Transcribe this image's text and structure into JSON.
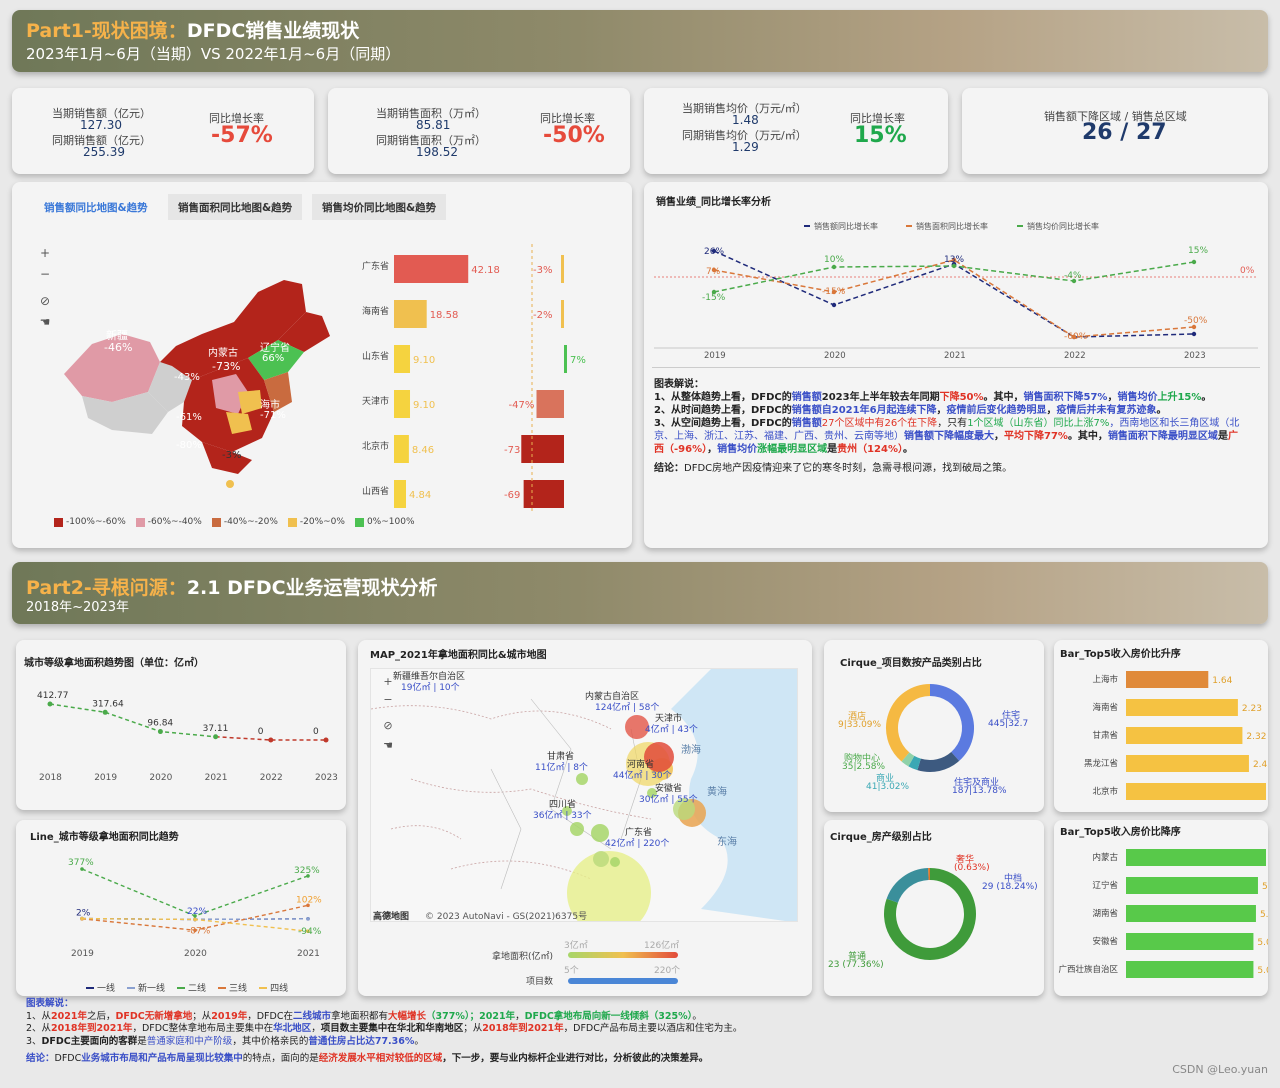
{
  "part1": {
    "title_hl": "Part1-现状困境",
    "title_sep": "：",
    "title_main": "DFDC销售业绩现状",
    "subtitle": "2023年1月~6月（当期）VS 2022年1月~6月（同期）"
  },
  "kpi": {
    "sales_cur_label": "当期销售额（亿元）",
    "sales_cur": "127.30",
    "sales_prev_label": "同期销售额（亿元）",
    "sales_prev": "255.39",
    "sales_yoy_label": "同比增长率",
    "sales_yoy": "-57%",
    "area_cur_label": "当期销售面积（万㎡）",
    "area_cur": "85.81",
    "area_prev_label": "同期销售面积（万㎡）",
    "area_prev": "198.52",
    "area_yoy_label": "同比增长率",
    "area_yoy": "-50%",
    "price_cur_label": "当期销售均价（万元/㎡）",
    "price_cur": "1.48",
    "price_prev_label": "同期销售均价（万元/㎡）",
    "price_prev": "1.29",
    "price_yoy_label": "同比增长率",
    "price_yoy": "15%",
    "region_label": "销售额下降区域 / 销售总区域",
    "region_value": "26 / 27"
  },
  "map_tabs": [
    "销售额同比地图&趋势",
    "销售面积同比地图&趋势",
    "销售均价同比地图&趋势"
  ],
  "map_labels": {
    "xinjiang": "新疆",
    "xinjiang_v": "-46%",
    "neimeng": "内蒙古",
    "liaoning": "辽宁省",
    "v66": "66%",
    "v73": "-73%",
    "v43": "-43%",
    "v61": "-61%",
    "v80": "-80%",
    "v3": "-3%",
    "shanghai": "海市",
    "v71": "-71%"
  },
  "provinces": {
    "names": [
      "广东省",
      "海南省",
      "山东省",
      "天津市",
      "北京市",
      "山西省"
    ],
    "values": [
      42.18,
      18.58,
      9.1,
      9.1,
      8.46,
      4.84
    ],
    "value_labels": [
      "42.18",
      "18.58",
      "9.10",
      "9.10",
      "8.46",
      "4.84"
    ],
    "yoy": [
      -3,
      -2,
      7,
      -47,
      -73,
      -69
    ],
    "yoy_labels": [
      "-3%",
      "-2%",
      "7%",
      "-47%",
      "-73",
      "-69"
    ]
  },
  "map_legend": [
    "-100%~-60%",
    "-60%~-40%",
    "-40%~-20%",
    "-20%~0%",
    "0%~100%"
  ],
  "map_legend_colors": [
    "#b3241b",
    "#e09aa6",
    "#c96b3f",
    "#f0c04f",
    "#4cc152"
  ],
  "trend": {
    "title": "销售业绩_同比增长率分析",
    "legend": [
      "销售额同比增长率",
      "销售面积同比增长率",
      "销售均价同比增长率"
    ],
    "chart_data": {
      "type": "line",
      "categories": [
        "2019",
        "2020",
        "2021",
        "2022",
        "2023"
      ],
      "series": [
        {
          "name": "销售额同比增长率",
          "values": [
            26,
            -28,
            13,
            -60,
            -57
          ],
          "color": "#1f2a7a"
        },
        {
          "name": "销售面积同比增长率",
          "values": [
            7,
            -15,
            17,
            -60,
            -50
          ],
          "color": "#d9773a"
        },
        {
          "name": "销售均价同比增长率",
          "values": [
            -15,
            10,
            11,
            -4,
            15
          ],
          "color": "#4aaa4a"
        }
      ],
      "point_labels": [
        "26%",
        "7%",
        "-15%",
        "10%",
        "-15%",
        "13%",
        "-4%",
        "-60%",
        "15%",
        "-50%",
        "0%"
      ]
    }
  },
  "analysis1": {
    "title": "图表解说：",
    "l1a": "1、从整体趋势上看，DFDC的",
    "l1b": "销售额",
    "l1c": "2023年上半年较去年同期",
    "l1d": "下降50%",
    "l1e": "。其中，",
    "l1f": "销售面积下降57%",
    "l1g": "，",
    "l1h": "销售均价",
    "l1i": "上升15%",
    "l1j": "。",
    "l2a": "2、从时间趋势上看，DFDC的",
    "l2b": "销售额自2021年6月起连续下降",
    "l2c": "，",
    "l2d": "疫情前后变化趋势明显",
    "l2e": "，",
    "l2f": "疫情后并未有复苏迹象",
    "l2g": "。",
    "l3a": "3、从空间趋势上看，DFDC的",
    "l3b": "销售额",
    "l3c": "27个区域中有26个在下降",
    "l3d": "，只有",
    "l3e": "1个区域（山东省）同比上涨7%",
    "l3f": "，西南地区和长三角区域（北",
    "l4a": "京、上海、浙江、江苏、福建、广西、贵州、云南等地）",
    "l4b": "销售额下降幅度最大",
    "l4c": "，",
    "l4d": "平均下降77%",
    "l4e": "。其中，",
    "l4f": "销售面积下降最明显区域",
    "l4g": "是",
    "l4h": "广",
    "l5a": "西（-96%）",
    "l5b": "，",
    "l5c": "销售均价",
    "l5d": "涨幅最明显区域",
    "l5e": "是",
    "l5f": "贵州（124%）",
    "l5g": "。",
    "conclusion_label": "结论：",
    "conclusion": "DFDC房地产因疫情迎来了它的寒冬时刻，急需寻根问源，找到破局之策。"
  },
  "part2": {
    "title_hl": "Part2-寻根问源",
    "title_sep": "：",
    "title_main": "2.1 DFDC业务运营现状分析",
    "subtitle": "2018年~2023年"
  },
  "land_area": {
    "title": "城市等级拿地面积趋势图（单位：亿㎡）",
    "chart_data": {
      "type": "line",
      "categories": [
        "2018",
        "2019",
        "2020",
        "2021",
        "2022",
        "2023"
      ],
      "values": [
        412.77,
        317.64,
        96.84,
        37.11,
        0,
        0
      ],
      "labels": [
        "412.77",
        "317.64",
        "96.84",
        "37.11",
        "0",
        "0"
      ]
    }
  },
  "land_yoy": {
    "title": "Line_城市等级拿地面积同比趋势",
    "chart_data": {
      "type": "line",
      "categories": [
        "2019",
        "2020",
        "2021"
      ],
      "series": [
        {
          "name": "一线",
          "color": "#1f2a7a",
          "values": [
            2,
            -5,
            0
          ]
        },
        {
          "name": "新一线",
          "color": "#8aa0d0",
          "values": [
            0,
            -5,
            0
          ]
        },
        {
          "name": "二线",
          "color": "#4aaa4a",
          "values": [
            377,
            22,
            325
          ]
        },
        {
          "name": "三线",
          "color": "#d9773a",
          "values": [
            0,
            -87,
            102
          ]
        },
        {
          "name": "四线",
          "color": "#f0c04f",
          "values": [
            2,
            -5,
            -94
          ]
        }
      ],
      "point_labels": [
        "377%",
        "2%",
        "22%",
        "-87%",
        "325%",
        "102%",
        "-94%"
      ]
    },
    "legend": [
      "一线",
      "新一线",
      "二线",
      "三线",
      "四线"
    ]
  },
  "land_map": {
    "title": "MAP_2021年拿地面积同比&城市地图",
    "labels": {
      "xj": "新疆维吾尔自治区",
      "xj_v": "19亿㎡ | 10个",
      "nm": "内蒙古自治区",
      "nm_v": "124亿㎡ | 58个",
      "tj": "天津市",
      "tj_v": "4亿㎡ | 43个",
      "gs": "甘肃省",
      "gs_v": "11亿㎡ | 8个",
      "hn": "河南省",
      "hn_v": "44亿㎡ | 30个",
      "ah": "安徽省",
      "ah_v": "30亿㎡ | 55个",
      "sc": "四川省",
      "sc_v": "36亿㎡ | 33个",
      "gd": "广东省",
      "gd_v": "42亿㎡ | 220个",
      "bh": "渤海",
      "hh": "黄海",
      "dh": "东海"
    },
    "copyright": "© 2023 AutoNavi - GS(2021)6375号",
    "brand": "高德地图",
    "legend1_label": "拿地面积(亿㎡)",
    "legend1_min": "3亿㎡",
    "legend1_max": "126亿㎡",
    "legend2_label": "项目数",
    "legend2_min": "5个",
    "legend2_max": "220个"
  },
  "cirque1": {
    "title": "Cirque_项目数按产品类别占比",
    "chart_data": {
      "type": "pie",
      "labels": [
        "住宅",
        "住宅及商业",
        "商业",
        "购物中心",
        "酒店"
      ],
      "values": [
        445,
        187,
        41,
        35,
        449
      ],
      "shares": [
        "32.7",
        "13.78%",
        "3.02%",
        "2.58%",
        "33.09%"
      ],
      "colors": [
        "#5b7ae0",
        "#3d5a80",
        "#3aa8b4",
        "#8fd1a8",
        "#f5b942"
      ]
    },
    "l_zz": "住宅",
    "l_zz_v": "445|32.7",
    "l_zs": "住宅及商业",
    "l_zs_v": "187|13.78%",
    "l_sy": "商业",
    "l_sy_v": "41|3.02%",
    "l_gw": "购物中心",
    "l_gw_v": "35|2.58%",
    "l_jd": "酒店",
    "l_jd_v": "9|33.09%"
  },
  "cirque2": {
    "title": "Cirque_房产级别占比",
    "chart_data": {
      "type": "pie",
      "labels": [
        "普通",
        "中档",
        "奢华"
      ],
      "values": [
        123,
        29,
        1
      ],
      "shares": [
        "77.36%",
        "18.24%",
        "0.63%"
      ],
      "colors": [
        "#3f9b3a",
        "#3a8f9b",
        "#e0782a"
      ]
    },
    "l_sh": "奢华",
    "l_sh_v": "(0.63%)",
    "l_zd": "中档",
    "l_zd_v": "29 (18.24%)",
    "l_pt": "普通",
    "l_pt_v": "23 (77.36%)"
  },
  "top5_asc": {
    "title": "Bar_Top5收入房价比升序",
    "chart_data": {
      "type": "bar",
      "categories": [
        "上海市",
        "海南省",
        "甘肃省",
        "黑龙江省",
        "北京市"
      ],
      "values": [
        1.64,
        2.23,
        2.32,
        2.45,
        2.79
      ],
      "labels": [
        "1.64",
        "2.23",
        "2.32",
        "2.45",
        "79"
      ]
    }
  },
  "top5_desc": {
    "title": "Bar_Top5收入房价比降序",
    "chart_data": {
      "type": "bar",
      "categories": [
        "内蒙古",
        "辽宁省",
        "湖南省",
        "安徽省",
        "广西壮族自治区"
      ],
      "values": [
        5.57,
        5.25,
        5.17,
        5.07,
        5.07
      ],
      "labels": [
        "57",
        "5.25",
        "5.17",
        "5.07",
        "5.07"
      ]
    }
  },
  "analysis2": {
    "title": "图表解说：",
    "l1a": "1、从",
    "l1b": "2021年",
    "l1c": "之后，",
    "l1d": "DFDC无新增拿地",
    "l1e": "；从",
    "l1f": "2019年",
    "l1g": "，DFDC在",
    "l1h": "二线城市",
    "l1i": "拿地面积都有",
    "l1j": "大幅增长",
    "l1k": "（377%）；",
    "l1l": "2021年",
    "l1m": "，",
    "l1n": "DFDC拿地布局向新一线倾斜（325%）",
    "l1o": "。",
    "l2a": "2、从",
    "l2b": "2018年到2021年",
    "l2c": "，DFDC整体拿地布局主要集中在",
    "l2d": "华北地区",
    "l2e": "，",
    "l2f": "项目数主要集中在华北和华南地区",
    "l2g": "；从",
    "l2h": "2018年到2021年",
    "l2i": "，DFDC产品布局主要以酒店和住宅为主。",
    "l3a": "3、",
    "l3b": "DFDC主要面向的客群",
    "l3c": "是",
    "l3d": "普通家庭和中产阶级",
    "l3e": "，其中价格亲民的",
    "l3f": "普通住房占比达77.36%",
    "l3g": "。",
    "c1": "结论：",
    "c2": "DFDC",
    "c3": "业务城市布局和产品布局呈现比较集中",
    "c4": "的特点，面向的是",
    "c5": "经济发展水平相对较低的区域",
    "c6": "，下一步，要与业内标杆企业进行对比，分析彼此的决策差异。"
  },
  "watermark": "CSDN @Leo.yuan"
}
